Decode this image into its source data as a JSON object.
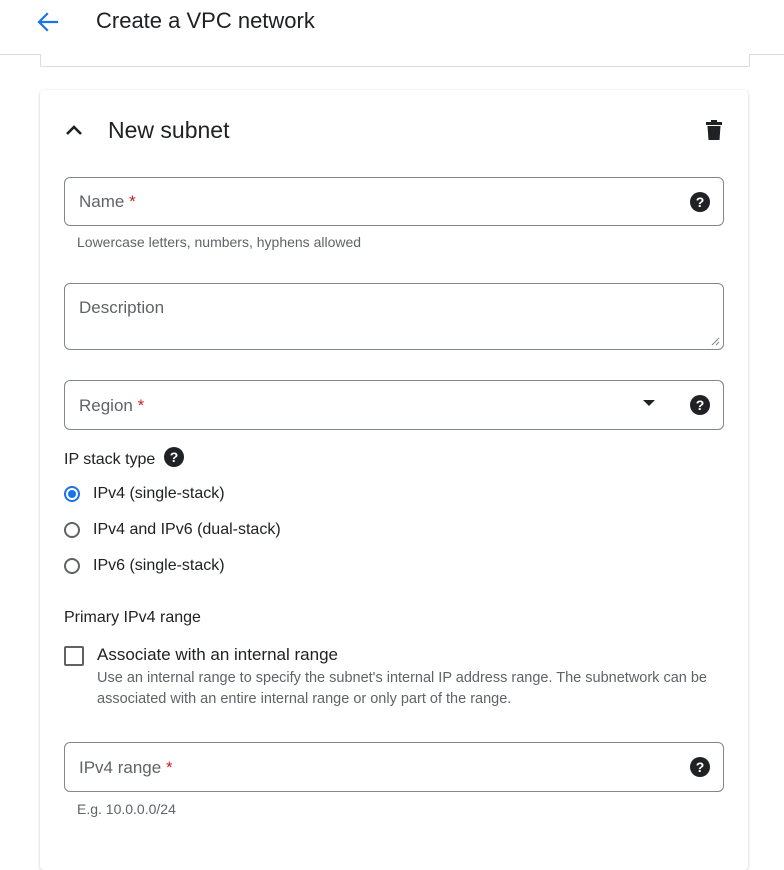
{
  "header": {
    "back_icon": "arrow-back-icon",
    "title": "Create a VPC network"
  },
  "subnet": {
    "collapse_icon": "chevron-up-icon",
    "title": "New subnet",
    "delete_icon": "delete-icon",
    "name": {
      "label": "Name",
      "required_mark": "*",
      "value": "",
      "hint": "Lowercase letters, numbers, hyphens allowed"
    },
    "description": {
      "label": "Description",
      "value": ""
    },
    "region": {
      "label": "Region",
      "required_mark": "*",
      "selected": ""
    },
    "ip_stack": {
      "label": "IP stack type",
      "options": [
        {
          "label": "IPv4 (single-stack)",
          "checked": true
        },
        {
          "label": "IPv4 and IPv6 (dual-stack)",
          "checked": false
        },
        {
          "label": "IPv6 (single-stack)",
          "checked": false
        }
      ]
    },
    "primary_range": {
      "label": "Primary IPv4 range",
      "associate_label": "Associate with an internal range",
      "associate_checked": false,
      "associate_desc": "Use an internal range to specify the subnet's internal IP address range. The subnetwork can be associated with an entire internal range or only part of the range."
    },
    "ipv4_range": {
      "label": "IPv4 range",
      "required_mark": "*",
      "value": "",
      "hint": "E.g. 10.0.0.0/24"
    }
  },
  "colors": {
    "accent": "#1a73e8",
    "required": "#c5221f",
    "text": "#202124",
    "muted": "#5f6368",
    "border": "#80868b"
  }
}
